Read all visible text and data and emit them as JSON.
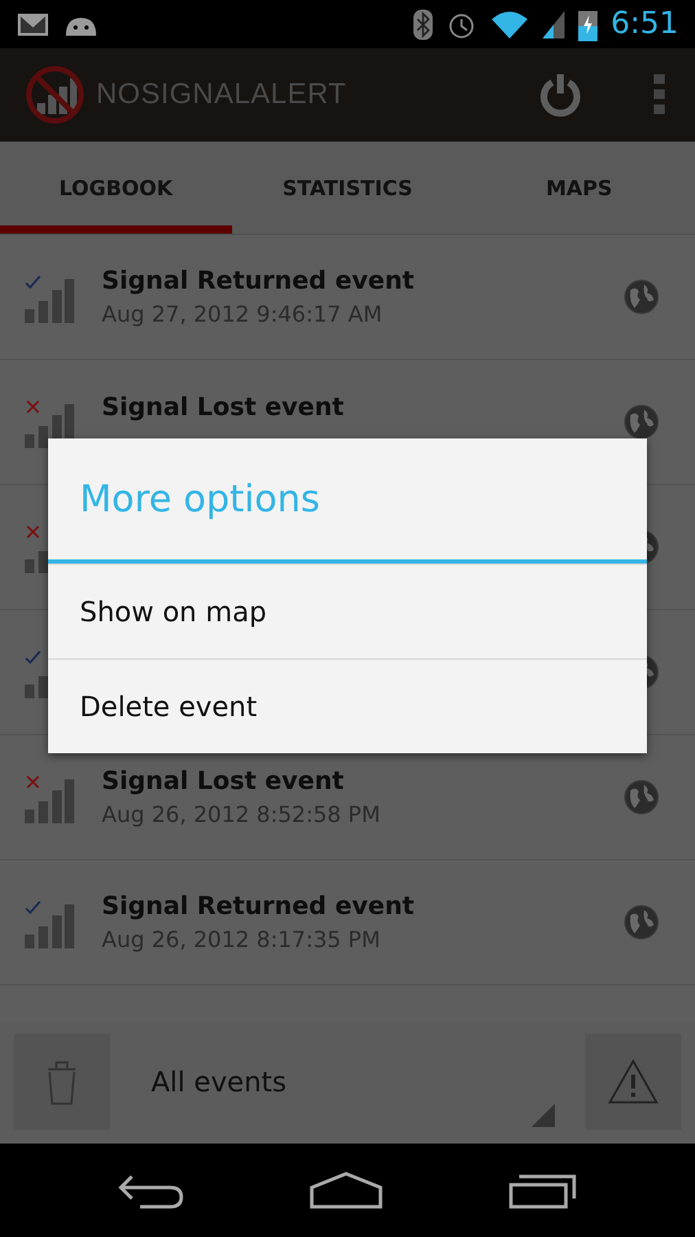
{
  "status_bar": {
    "time": "6:51"
  },
  "action_bar": {
    "title": "NOSIGNALALERT"
  },
  "tabs": [
    {
      "label": "LOGBOOK",
      "selected": true
    },
    {
      "label": "STATISTICS",
      "selected": false
    },
    {
      "label": "MAPS",
      "selected": false
    }
  ],
  "events": [
    {
      "kind": "returned",
      "title": "Signal Returned event",
      "date": "Aug 27, 2012 9:46:17 AM"
    },
    {
      "kind": "lost",
      "title": "Signal Lost event"
    },
    {
      "kind": "lost"
    },
    {
      "kind": "returned"
    },
    {
      "kind": "lost",
      "title": "Signal Lost event",
      "date": "Aug 26, 2012 8:52:58 PM"
    },
    {
      "kind": "returned",
      "title": "Signal Returned event",
      "date": "Aug 26, 2012 8:17:35 PM"
    }
  ],
  "bottom_bar": {
    "filter": "All events"
  },
  "dialog": {
    "title": "More options",
    "items": [
      "Show on map",
      "Delete event"
    ]
  }
}
